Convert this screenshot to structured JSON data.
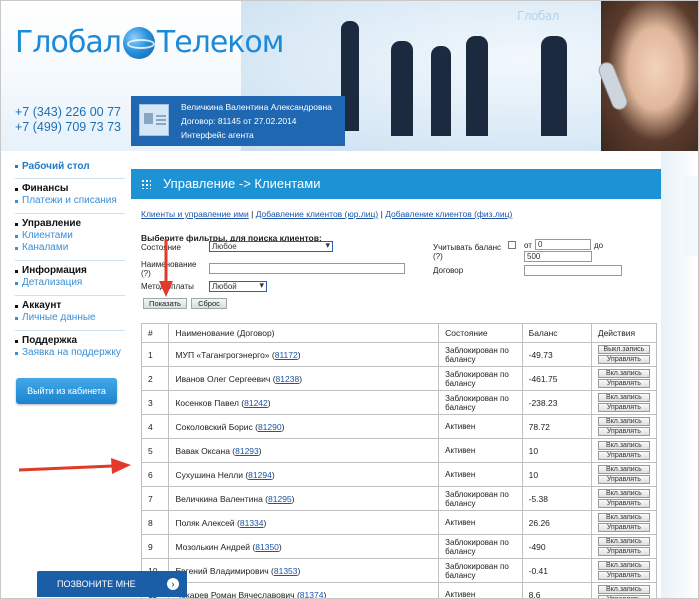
{
  "brand": {
    "logo_left": "Глобал",
    "logo_right": "Телеком",
    "logo_small": "Глобал"
  },
  "phones": [
    "+7 (343) 226 00 77",
    "+7 (499) 709 73 73"
  ],
  "user": {
    "name": "Величкина Валентина Александровна",
    "contract": "Договор: 81145 от 27.02.2014",
    "interface": "Интерфейс агента"
  },
  "sidebar": {
    "top": "Рабочий стол",
    "groups": [
      {
        "title": "Финансы",
        "links": [
          "Платежи и списания"
        ]
      },
      {
        "title": "Управление",
        "links": [
          "Клиентами",
          "Каналами"
        ]
      },
      {
        "title": "Информация",
        "links": [
          "Детализация"
        ]
      },
      {
        "title": "Аккаунт",
        "links": [
          "Личные данные"
        ]
      },
      {
        "title": "Поддержка",
        "links": [
          "Заявка на поддержку"
        ]
      }
    ],
    "logout": "Выйти из кабинета"
  },
  "page": {
    "title": "Управление -> Клиентами",
    "tabs": [
      "Клиенты и управление ими",
      "Добавление клиентов (юр.лиц)",
      "Добавление клиентов (физ.лиц)"
    ],
    "tab_separator": " | "
  },
  "filters": {
    "heading": "Выберите фильтры, для поиска клиентов:",
    "state_label": "Состояние",
    "state_value": "Любое",
    "name_label": "Наименование",
    "name_hint": "(?)",
    "payment_label": "Метод оплаты",
    "payment_value": "Любой",
    "balance_label": "Учитывать баланс",
    "balance_hint": "(?)",
    "from_label": "от",
    "from_value": "0",
    "to_label": "до",
    "to_value": "500",
    "contract_label": "Договор",
    "show_button": "Показать",
    "reset_button": "Сброс"
  },
  "table": {
    "headers": [
      "#",
      "Наименование (Договор)",
      "Состояние",
      "Баланс",
      "Действия"
    ],
    "rows": [
      {
        "num": "1",
        "name": "МУП «Тагангрогэнерго»",
        "contract": "81172",
        "state": "Заблокирован по балансу",
        "balance": "-49.73",
        "action1": "Выкл.запись",
        "action2": "Управлять"
      },
      {
        "num": "2",
        "name": "Иванов Олег Сергеевич",
        "contract": "81238",
        "state": "Заблокирован по балансу",
        "balance": "-461.75",
        "action1": "Вкл.запись",
        "action2": "Управлять"
      },
      {
        "num": "3",
        "name": "Косенков Павел",
        "contract": "81242",
        "state": "Заблокирован по балансу",
        "balance": "-238.23",
        "action1": "Вкл.запись",
        "action2": "Управлять"
      },
      {
        "num": "4",
        "name": "Соколовский Борис",
        "contract": "81290",
        "state": "Активен",
        "balance": "78.72",
        "action1": "Вкл.запись",
        "action2": "Управлять"
      },
      {
        "num": "5",
        "name": "Вавак Оксана",
        "contract": "81293",
        "state": "Активен",
        "balance": "10",
        "action1": "Вкл.запись",
        "action2": "Управлять"
      },
      {
        "num": "6",
        "name": "Сухушина Нелли",
        "contract": "81294",
        "state": "Активен",
        "balance": "10",
        "action1": "Вкл.запись",
        "action2": "Управлять"
      },
      {
        "num": "7",
        "name": "Величкина Валентина",
        "contract": "81295",
        "state": "Заблокирован по балансу",
        "balance": "-5.38",
        "action1": "Вкл.запись",
        "action2": "Управлять"
      },
      {
        "num": "8",
        "name": "Поляк Алексей",
        "contract": "81334",
        "state": "Активен",
        "balance": "26.26",
        "action1": "Вкл.запись",
        "action2": "Управлять"
      },
      {
        "num": "9",
        "name": "Мозолькин Андрей",
        "contract": "81350",
        "state": "Заблокирован по балансу",
        "balance": "-490",
        "action1": "Вкл.запись",
        "action2": "Управлять"
      },
      {
        "num": "10",
        "name": "Евгений Владимирович",
        "contract": "81353",
        "state": "Заблокирован по балансу",
        "balance": "-0.41",
        "action1": "Вкл.запись",
        "action2": "Управлять"
      },
      {
        "num": "11",
        "name": "Чекарев Роман Вячеславович",
        "contract": "81374",
        "state": "Активен",
        "balance": "8.6",
        "action1": "Вкл.запись",
        "action2": "Управлять"
      }
    ]
  },
  "callme": {
    "label": "ПОЗВОНИТЕ МНЕ"
  },
  "colors": {
    "accent": "#1d92d4",
    "brand": "#1f67b1",
    "arrow": "#e23a2a"
  }
}
